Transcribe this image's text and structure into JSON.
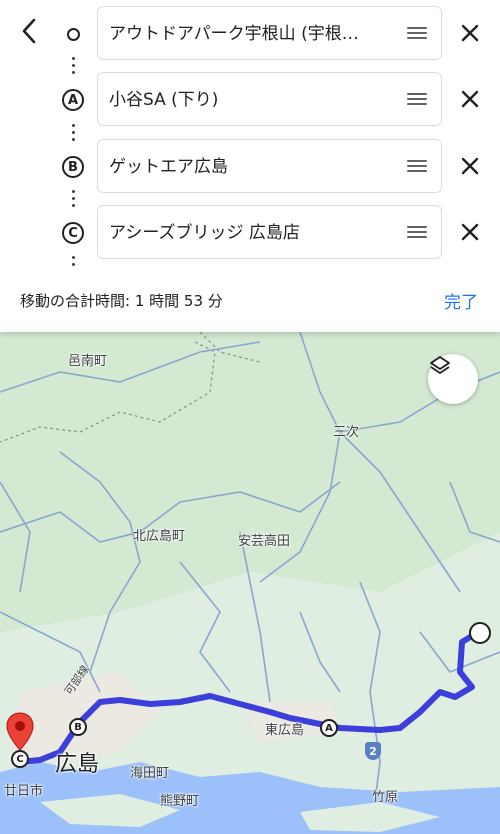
{
  "header": {
    "back_icon": "back-arrow-icon",
    "stops": [
      {
        "marker": "",
        "marker_icon": "origin-circle-icon",
        "text": "アウトドアパーク宇根山 (宇根山天文台)",
        "display": "アウトドアパーク宇根山 (宇根…"
      },
      {
        "marker": "A",
        "text": "小谷SA (下り)"
      },
      {
        "marker": "B",
        "text": "ゲットエア広島"
      },
      {
        "marker": "C",
        "text": "アシーズブリッジ 広島店"
      }
    ],
    "handle_icon": "drag-handle-icon",
    "remove_icon": "close-icon",
    "summary": "移動の合計時間: 1 時間 53 分",
    "done_label": "完了"
  },
  "map": {
    "labels": [
      "邑南町",
      "三次",
      "北広島町",
      "安芸高田",
      "東広島",
      "広島",
      "海田町",
      "熊野町",
      "廿日市",
      "竹原",
      "可部線"
    ],
    "waypoints": [
      "A",
      "B",
      "C"
    ],
    "route_badge": "2",
    "layers_icon": "layers-icon",
    "destination_pin_icon": "red-pin-icon",
    "route_color": "#3c3fd9",
    "water_color": "#9cc0f9",
    "land_color": "#dfeee0"
  }
}
